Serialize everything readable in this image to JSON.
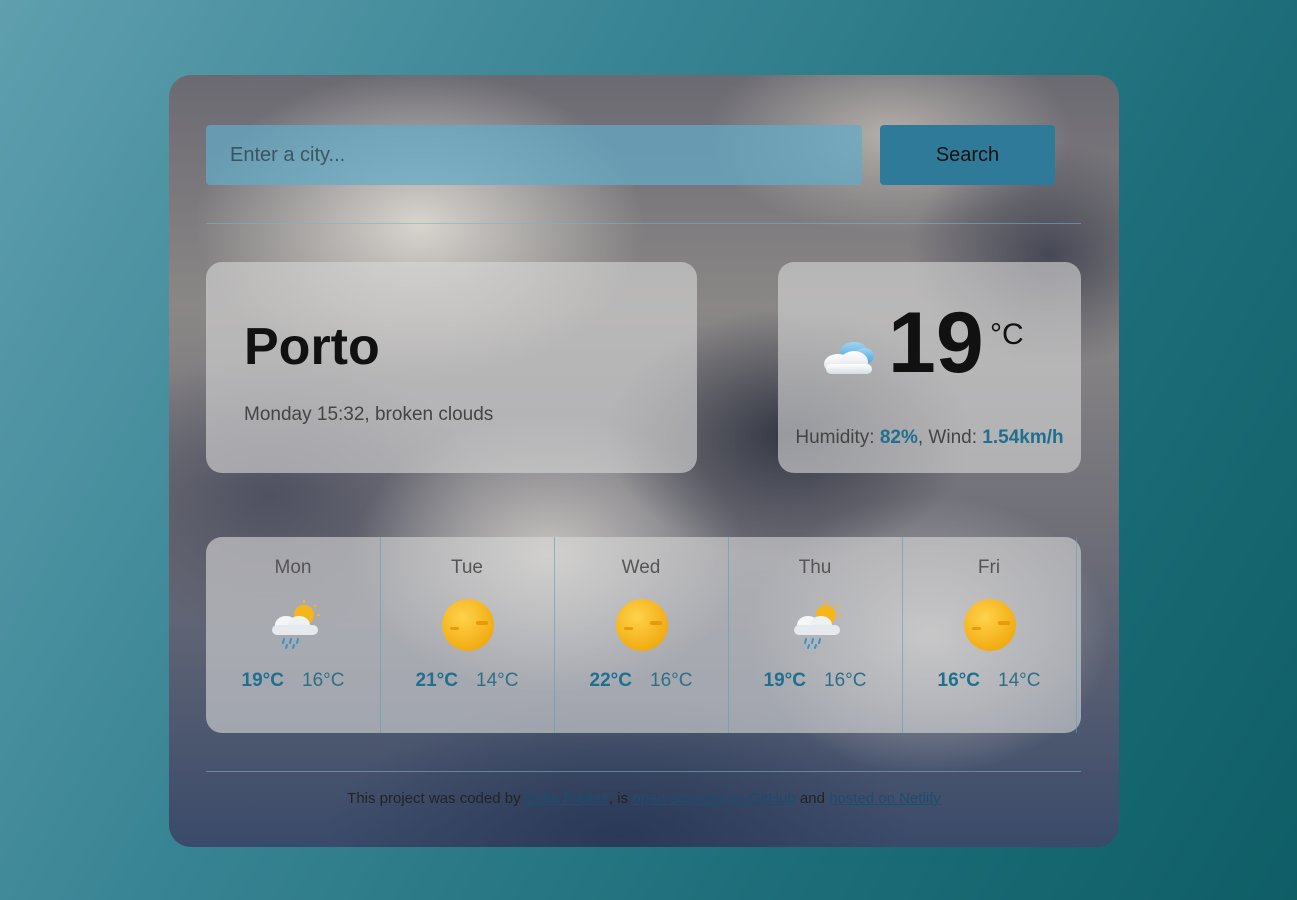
{
  "search": {
    "placeholder": "Enter a city...",
    "button_label": "Search"
  },
  "current": {
    "city": "Porto",
    "description": "Monday 15:32, broken clouds",
    "temperature": "19",
    "unit": "°C",
    "humidity_label": "Humidity: ",
    "humidity_value": "82%",
    "wind_label": ", Wind: ",
    "wind_value": "1.54km/h",
    "icon": "cloud-icon"
  },
  "forecast": [
    {
      "day": "Mon",
      "icon": "rain-sun-icon",
      "max": "19°C",
      "min": "16°C"
    },
    {
      "day": "Tue",
      "icon": "sun-icon",
      "max": "21°C",
      "min": "14°C"
    },
    {
      "day": "Wed",
      "icon": "sun-icon",
      "max": "22°C",
      "min": "16°C"
    },
    {
      "day": "Thu",
      "icon": "rain-sun-icon",
      "max": "19°C",
      "min": "16°C"
    },
    {
      "day": "Fri",
      "icon": "sun-icon",
      "max": "16°C",
      "min": "14°C"
    }
  ],
  "footer": {
    "prefix": "This project was coded by ",
    "author_link": "Sofia Freitas",
    "middle": ", is ",
    "github_link": "open-sourced on GitHub",
    "and": " and ",
    "netlify_link": "hosted on Netlify"
  },
  "colors": {
    "accent": "#1f6f8e",
    "button": "#2f7a98"
  }
}
